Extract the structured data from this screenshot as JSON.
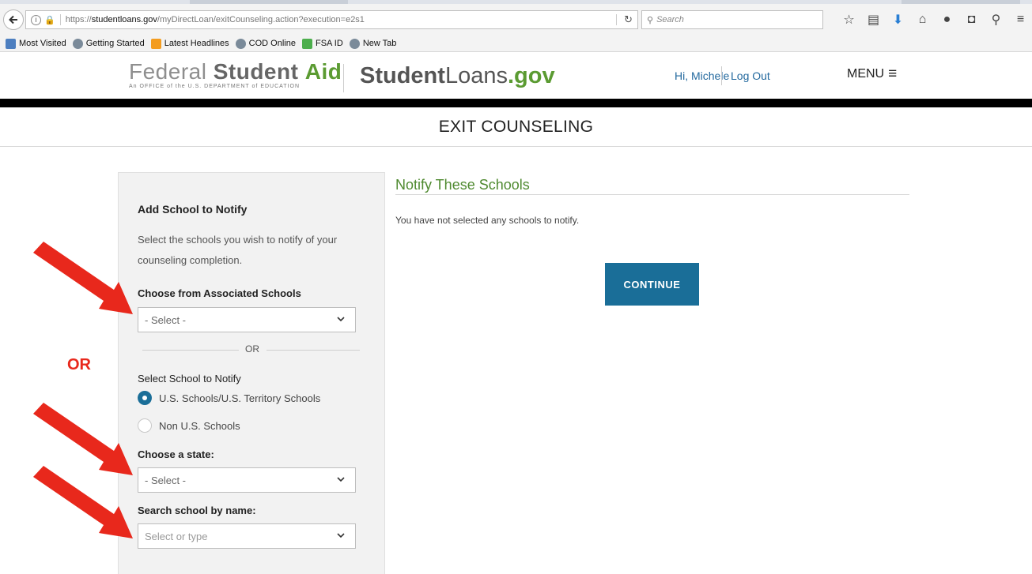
{
  "browser": {
    "url_prefix": "https://",
    "url_domain": "studentloans.gov",
    "url_path": "/myDirectLoan/exitCounseling.action?execution=e2s1",
    "search_placeholder": "Search",
    "bookmarks": [
      {
        "label": "Most Visited",
        "icon": "bookmark-icon"
      },
      {
        "label": "Getting Started",
        "icon": "globe-icon"
      },
      {
        "label": "Latest Headlines",
        "icon": "rss-icon"
      },
      {
        "label": "COD Online",
        "icon": "globe-icon"
      },
      {
        "label": "FSA ID",
        "icon": "green-box-icon"
      },
      {
        "label": "New Tab",
        "icon": "globe-icon"
      }
    ]
  },
  "header": {
    "fsa_word1": "Federal",
    "fsa_word2": "Student",
    "fsa_word3": "Aid",
    "fsa_tagline": "An OFFICE of the U.S. DEPARTMENT of EDUCATION",
    "sl_word1": "Student",
    "sl_word2": "Loans",
    "sl_tld": ".gov",
    "greeting": "Hi, Michele",
    "logout": "Log Out",
    "menu": "MENU"
  },
  "page": {
    "title": "EXIT COUNSELING"
  },
  "left_panel": {
    "title": "Add School to Notify",
    "description": "Select the schools you wish to notify of your counseling completion.",
    "associated_label": "Choose from Associated Schools",
    "associated_value": "- Select -",
    "or_divider": "OR",
    "select_school_label": "Select School to Notify",
    "radio_us": "U.S. Schools/U.S. Territory Schools",
    "radio_non_us": "Non U.S. Schools",
    "selected_radio": "U.S. Schools/U.S. Territory Schools",
    "state_label": "Choose a state:",
    "state_value": "- Select -",
    "search_label": "Search school by name:",
    "search_placeholder": "Select or type"
  },
  "main": {
    "heading": "Notify These Schools",
    "message": "You have not selected any schools to notify.",
    "continue_button": "CONTINUE"
  },
  "annotations": {
    "or_text": "OR",
    "arrow_color": "#e8281c"
  },
  "colors": {
    "brand_green": "#5b9b32",
    "button_blue": "#1a6e98",
    "link_blue": "#23699e"
  }
}
